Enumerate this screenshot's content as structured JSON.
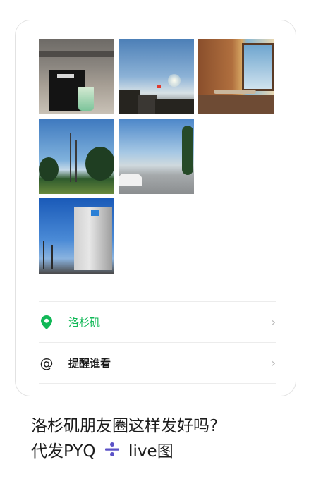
{
  "post": {
    "photos": [
      {
        "icon": "photo-coffee-shop"
      },
      {
        "icon": "photo-street-sunset"
      },
      {
        "icon": "photo-cafe-interior"
      },
      {
        "icon": "photo-palm-street"
      },
      {
        "icon": "photo-intersection"
      },
      {
        "icon": "photo-tall-building"
      }
    ],
    "location": {
      "label": "洛杉矶",
      "icon": "location-pin-icon",
      "color": "#11b857"
    },
    "mention": {
      "label": "提醒谁看",
      "icon": "at-icon"
    }
  },
  "caption": {
    "line1": "洛杉矶朋友圈这样发好吗?",
    "line2_prefix": "代发PYQ",
    "line2_suffix": "live图",
    "accent_color": "#5b52c7"
  }
}
